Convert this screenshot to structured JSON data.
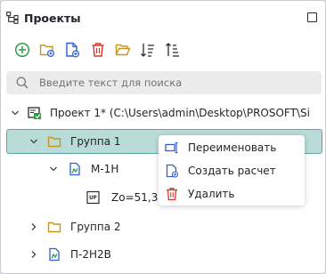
{
  "panel": {
    "title": "Проекты",
    "tree_icon": "hierarchy-icon",
    "maximize_icon": "maximize-icon"
  },
  "toolbar": {
    "buttons": [
      {
        "name": "add",
        "icon": "add-circle-icon",
        "color": "#2e9e45"
      },
      {
        "name": "new-folder",
        "icon": "folder-add-icon",
        "color": "#c8961e"
      },
      {
        "name": "new-file",
        "icon": "file-add-icon",
        "color": "#2f5fd0"
      },
      {
        "name": "delete",
        "icon": "trash-icon",
        "color": "#d9342b"
      },
      {
        "name": "open-folder",
        "icon": "folder-open-icon",
        "color": "#c8961e"
      },
      {
        "name": "sort-asc",
        "icon": "sort-asc-icon",
        "color": "#2b2b2b"
      },
      {
        "name": "sort-desc",
        "icon": "sort-desc-icon",
        "color": "#2b2b2b"
      }
    ]
  },
  "search": {
    "placeholder": "Введите текст для поиска",
    "value": ""
  },
  "tree": {
    "project": {
      "label": "Проект 1* (C:\\Users\\admin\\Desktop\\PROSOFT\\Si",
      "icon": "project-icon"
    },
    "group1": {
      "label": "Группа 1",
      "icon": "folder-icon"
    },
    "m1h": {
      "label": "М-1Н",
      "icon": "calc-file-icon"
    },
    "zo": {
      "label": "Zo=51,34",
      "badge": "UF",
      "icon": "result-icon"
    },
    "group2": {
      "label": "Группа 2",
      "icon": "folder-icon"
    },
    "p2h2b": {
      "label": "П-2Н2В",
      "icon": "calc-file-icon"
    }
  },
  "context_menu": {
    "items": [
      {
        "label": "Переименовать",
        "icon": "rename-icon"
      },
      {
        "label": "Создать расчет",
        "icon": "file-add-icon"
      },
      {
        "label": "Удалить",
        "icon": "trash-icon"
      }
    ]
  },
  "colors": {
    "selection_bg": "#b9dcd9",
    "selection_border": "#5fa5a1",
    "accent_blue": "#2f5fd0",
    "folder": "#c8961e",
    "delete_red": "#d9342b",
    "add_green": "#2e9e45",
    "project_green": "#2e9e45"
  }
}
